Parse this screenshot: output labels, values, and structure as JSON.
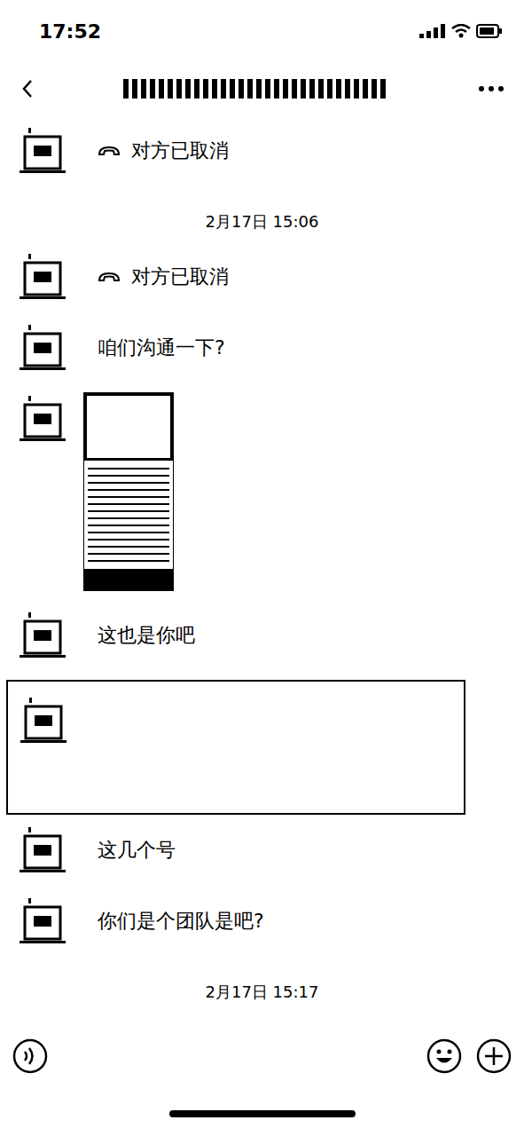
{
  "status_bar": {
    "time": "17:52"
  },
  "messages": [
    {
      "kind": "call",
      "text": "对方已取消"
    },
    {
      "kind": "time",
      "text": "2月17日 15:06"
    },
    {
      "kind": "call",
      "text": "对方已取消"
    },
    {
      "kind": "text",
      "text": "咱们沟通一下?"
    },
    {
      "kind": "image"
    },
    {
      "kind": "text",
      "text": "这也是你吧"
    },
    {
      "kind": "redacted"
    },
    {
      "kind": "text",
      "text": "这几个号"
    },
    {
      "kind": "text",
      "text": "你们是个团队是吧?"
    },
    {
      "kind": "time",
      "text": "2月17日 15:17"
    }
  ]
}
